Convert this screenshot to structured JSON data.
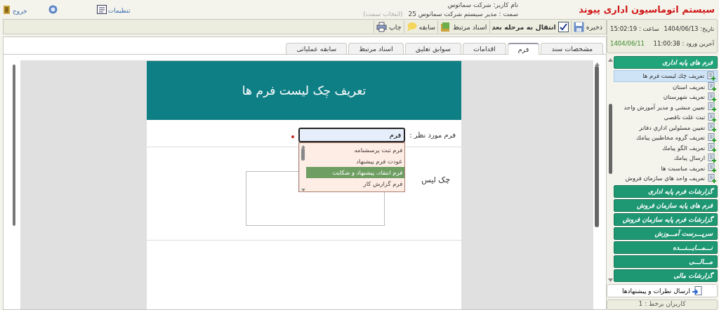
{
  "header": {
    "app_title": "سیستم اتوماسیون اداری پیوند",
    "user_name": "نام کاربر: شرکت سماتوس",
    "role": "سمت : مدیر سیستم شرکت سماتوس 25",
    "role_link": "(انتخاب سمت)",
    "links": [
      {
        "label": "تنظیمات",
        "kind": "settings"
      },
      {
        "kind": "help"
      },
      {
        "label": "خروج",
        "kind": "exit"
      }
    ]
  },
  "toolbar": [
    {
      "label": "ذخیره",
      "kind": "save"
    },
    {
      "label": "انتقال به مرحله بعد",
      "kind": "next"
    },
    {
      "label": "اسناد مرتبط",
      "kind": "docs"
    },
    {
      "label": "سابقه",
      "kind": "history"
    },
    {
      "label": "چاپ",
      "kind": "print"
    }
  ],
  "date_box": {
    "date": "تاریخ: 1404/06/13",
    "time": "ساعت : 15:02:19",
    "last_login": "آخرین ورود : 11:00:38",
    "last_login_date": "1404/06/11"
  },
  "tabs": [
    {
      "label": "مشخصات سند",
      "selected": false
    },
    {
      "label": "فرم",
      "selected": true
    },
    {
      "label": "اقدامات",
      "selected": false
    },
    {
      "label": "سوابق تعلیق",
      "selected": false
    },
    {
      "label": "اسناد مرتبط",
      "selected": false
    },
    {
      "label": "سابقه عملیاتی",
      "selected": false
    }
  ],
  "form": {
    "title": "تعریف چک لیست فرم ها",
    "field_label": "فرم مورد نظر :",
    "field_value": "فرم",
    "required": true,
    "checklist_label": "چک لیس",
    "options": [
      {
        "label": "فرم ثبت پرسشنامه",
        "selected": false
      },
      {
        "label": "عودت فرم پیشنهاد",
        "selected": false
      },
      {
        "label": "فرم انتقاد، پیشنهاد و شکایت",
        "selected": true
      },
      {
        "label": "فرم گزارش کار",
        "selected": false
      }
    ]
  },
  "sidebar": {
    "groups": [
      {
        "label": "فرم های پایه اداری",
        "expanded": true,
        "children": [
          {
            "label": "تعریف چك ليست فرم ها",
            "selected": true
          },
          {
            "label": "تعریف استان",
            "selected": false
          },
          {
            "label": "تعریف شهرستان",
            "selected": false
          },
          {
            "label": "تعيين منشي و مدير آموزش واحد",
            "selected": false
          },
          {
            "label": "ثبت علت ناقصي",
            "selected": false
          },
          {
            "label": "تعيين مسئولين اداري دفاتر",
            "selected": false
          },
          {
            "label": "تعریف گروه مخاطبين پيامك",
            "selected": false
          },
          {
            "label": "تعریف الگو پيامك",
            "selected": false
          },
          {
            "label": "ارسال پيامك",
            "selected": false
          },
          {
            "label": "تعریف مناسبت ها",
            "selected": false
          },
          {
            "label": "تعریف واحد هاي سازمان فروش",
            "selected": false
          }
        ]
      },
      {
        "label": "گزارشات فرم پایه اداری",
        "expanded": false
      },
      {
        "label": "فرم های پایه سازمان فروش",
        "expanded": false
      },
      {
        "label": "گزارشات فرم پایه سازمان فروش",
        "expanded": false
      },
      {
        "label": "سرپـــرست آمـــوزش",
        "expanded": false
      },
      {
        "label": "نـــمـــایـــنـــده",
        "expanded": false
      },
      {
        "label": "مـــالـــی",
        "expanded": false
      },
      {
        "label": "گزارشات مالی",
        "expanded": false
      }
    ],
    "feedback_button": "ارسال نظرات و پیشنهادها",
    "online_users": "کاربران برخط : 1"
  }
}
